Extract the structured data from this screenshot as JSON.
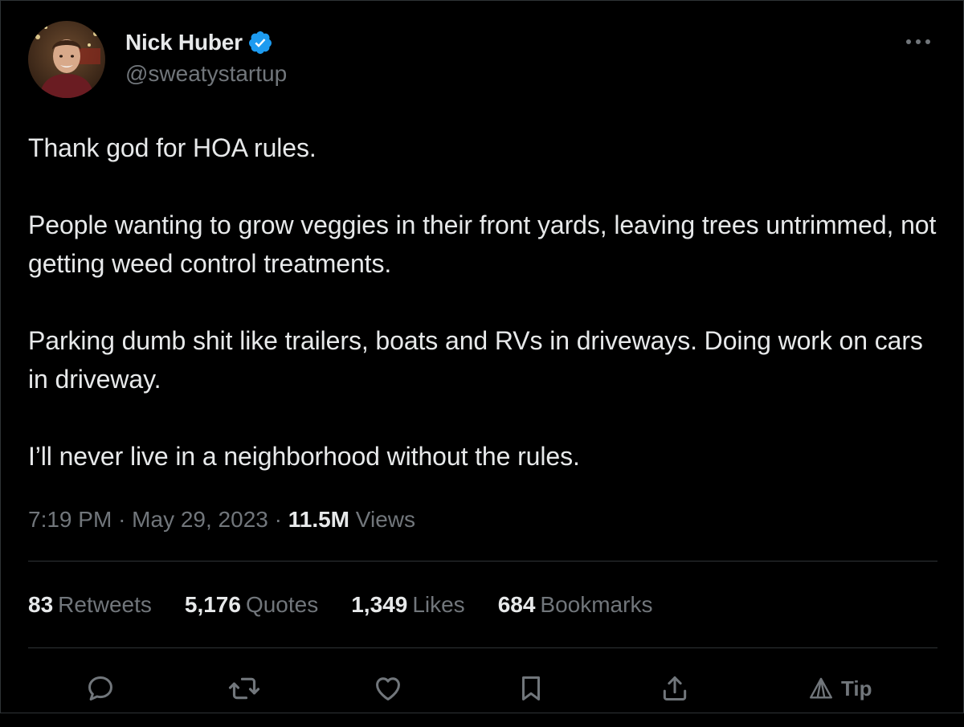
{
  "author": {
    "display_name": "Nick Huber",
    "handle": "@sweatystartup",
    "verified_icon": "verified-badge-icon",
    "verified_color": "#1d9bf0"
  },
  "more_icon": "more-horizontal-icon",
  "tweet": {
    "paragraphs": [
      "Thank god for HOA rules.",
      "People wanting to grow veggies in their front yards, leaving trees untrimmed, not getting weed control treatments.",
      "Parking dumb shit like trailers, boats and RVs in driveways. Doing work on cars in driveway.",
      "I’ll never live in a neighborhood without the rules."
    ]
  },
  "meta": {
    "time": "7:19 PM",
    "separator": "·",
    "date": "May 29, 2023",
    "views_count": "11.5M",
    "views_label": "Views"
  },
  "stats": [
    {
      "count": "83",
      "label": "Retweets"
    },
    {
      "count": "5,176",
      "label": "Quotes"
    },
    {
      "count": "1,349",
      "label": "Likes"
    },
    {
      "count": "684",
      "label": "Bookmarks"
    }
  ],
  "actions": {
    "icons": [
      "reply-icon",
      "retweet-icon",
      "like-icon",
      "bookmark-icon",
      "share-icon",
      "tip-icon"
    ],
    "tip_label": "Tip"
  },
  "colors": {
    "background": "#000000",
    "primary_text": "#e7e9ea",
    "secondary_text": "#71767b",
    "border": "#2f3336"
  }
}
